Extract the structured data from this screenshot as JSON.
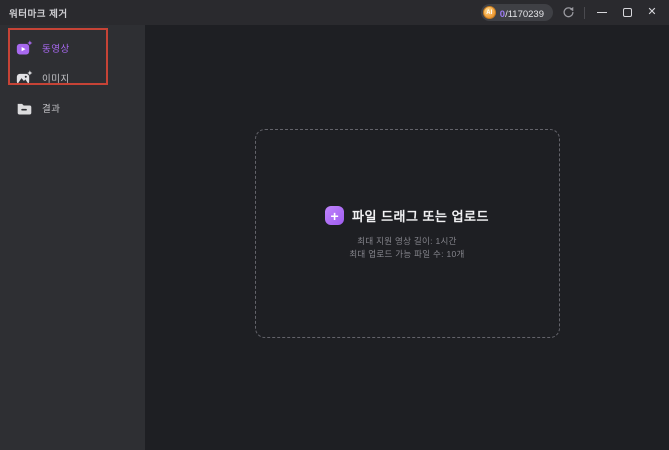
{
  "window": {
    "title": "워터마크 제거"
  },
  "titlebar": {
    "credits": {
      "coin_label": "AI",
      "used": "0",
      "total": "/1170239"
    }
  },
  "sidebar": {
    "items": [
      {
        "label": "동영상",
        "active": true
      },
      {
        "label": "이미지",
        "active": false
      },
      {
        "label": "결과",
        "active": false
      }
    ]
  },
  "main": {
    "upload": {
      "plus_label": "+",
      "title": "파일 드래그 또는 업로드",
      "hint_video_length": "최대 지원 영상 길이: 1시간",
      "hint_file_count": "최대 업로드 가능 파일 수: 10개"
    }
  },
  "colors": {
    "accent_purple": "#a869f0",
    "annotation_red": "#c64336",
    "coin_gold": "#f0a03c",
    "sidebar_bg": "#2e2f33",
    "main_bg": "#1e1f23",
    "titlebar_bg": "#2a2a2e"
  }
}
